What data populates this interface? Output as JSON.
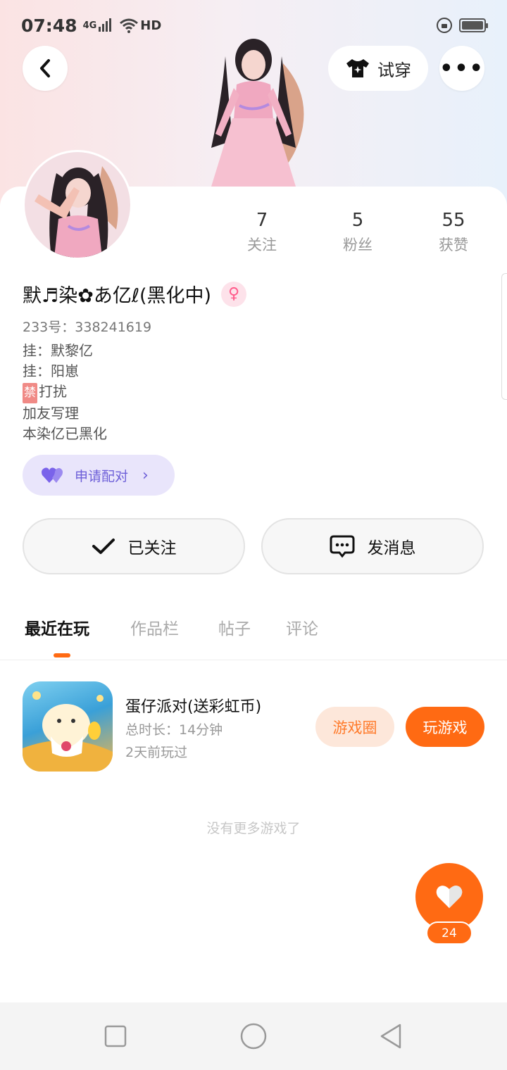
{
  "status_bar": {
    "time": "07:48",
    "network": "4G",
    "hd_label": "HD"
  },
  "header": {
    "try_on_label": "试穿",
    "more_label": "•••"
  },
  "stats": [
    {
      "value": "7",
      "label": "关注"
    },
    {
      "value": "5",
      "label": "粉丝"
    },
    {
      "value": "55",
      "label": "获赞"
    }
  ],
  "profile": {
    "nickname": "默♬染✿あ亿ℓ(黑化中)",
    "gender_symbol": "♀",
    "uid": "233号：338241619",
    "bio_lines": [
      "挂：默黎亿",
      "挂：阳崽",
      "打扰",
      "加友写理",
      "本染亿已黑化"
    ],
    "ban_badge": "禁"
  },
  "pair": {
    "label": "申请配对"
  },
  "actions": {
    "follow_label": "已关注",
    "message_label": "发消息"
  },
  "tabs": [
    {
      "label": "最近在玩",
      "active": true
    },
    {
      "label": "作品栏",
      "active": false
    },
    {
      "label": "帖子",
      "active": false
    },
    {
      "label": "评论",
      "active": false
    }
  ],
  "game": {
    "name": "蛋仔派对(送彩虹币)",
    "duration": "总时长：14分钟",
    "last_played": "2天前玩过",
    "circle_label": "游戏圈",
    "play_label": "玩游戏"
  },
  "no_more_text": "没有更多游戏了",
  "like": {
    "count": "24"
  },
  "colors": {
    "accent_orange": "#ff6a13",
    "pair_purple": "#6d5fd8",
    "gender_pink": "#ff5a8a"
  }
}
